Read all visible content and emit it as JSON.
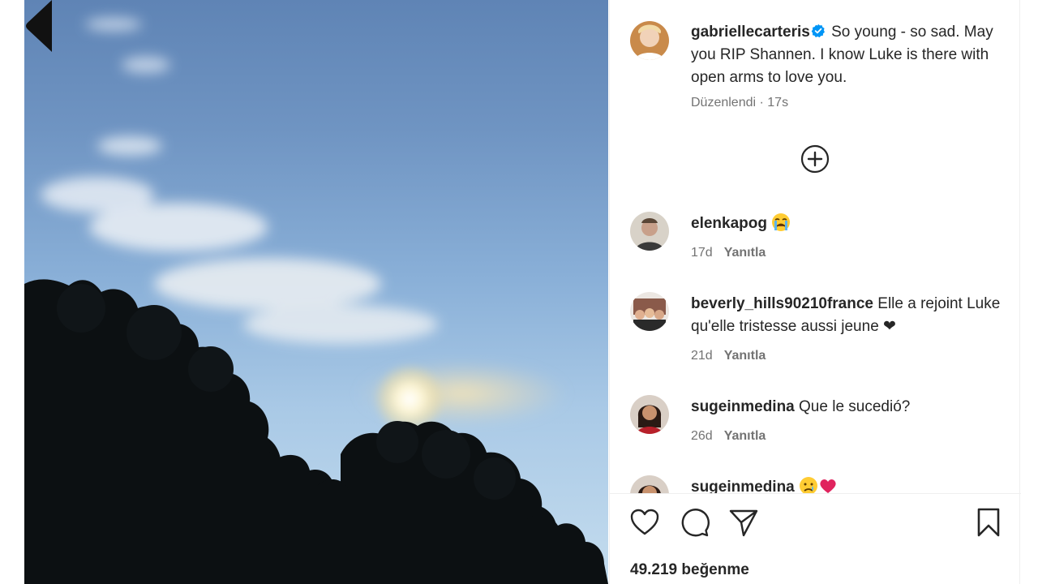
{
  "post": {
    "author": "gabriellecarteris",
    "caption": "So young - so sad. May you RIP Shannen. I know Luke is there with open arms to love you.",
    "edited_label": "Düzenlendi",
    "time": "17s",
    "likes": "49.219 beğenme"
  },
  "comments": [
    {
      "user": "elenkapog",
      "text": "",
      "emojis": [
        "crying-face"
      ],
      "time": "17d",
      "reply": "Yanıtla"
    },
    {
      "user": "beverly_hills90210france",
      "text": "Elle a rejoint Luke qu'elle tristesse aussi jeune ❤",
      "time": "21d",
      "reply": "Yanıtla"
    },
    {
      "user": "sugeinmedina",
      "text": "Que le sucedió?",
      "time": "26d",
      "reply": "Yanıtla"
    },
    {
      "user": "sugeinmedina",
      "text": "",
      "emojis": [
        "sad-face",
        "red-heart"
      ],
      "time": "",
      "reply": ""
    }
  ],
  "icons": {
    "verified": "verified-badge-icon",
    "load_more": "plus-circle-icon",
    "like": "heart-icon",
    "comment": "comment-bubble-icon",
    "share": "paper-plane-icon",
    "save": "bookmark-icon"
  },
  "colors": {
    "verified": "#0095f6",
    "text": "#262626",
    "muted": "#737373",
    "heart": "#e0245e"
  }
}
